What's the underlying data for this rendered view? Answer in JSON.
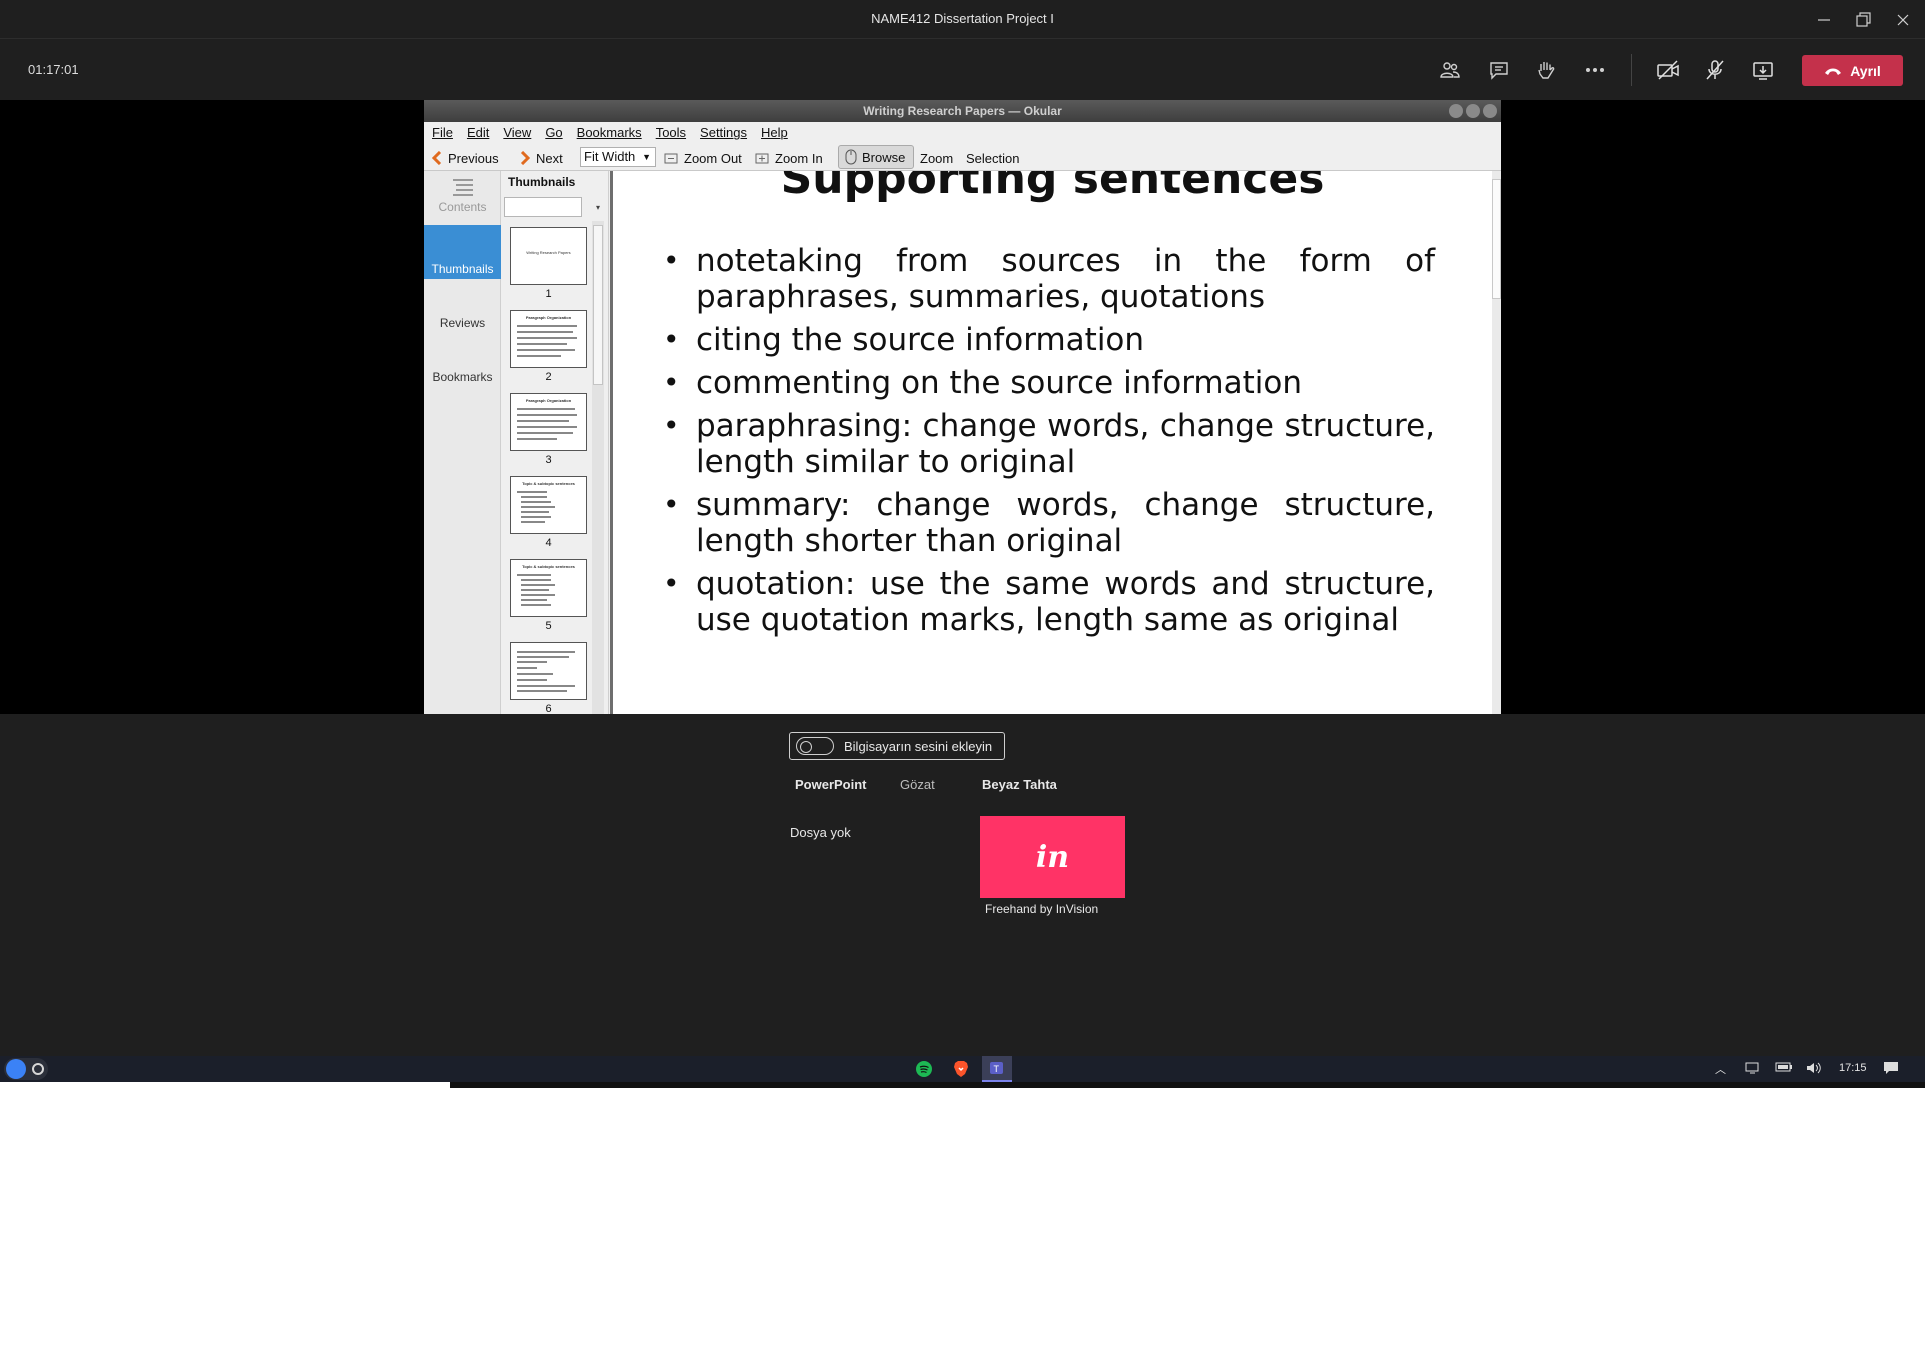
{
  "teams": {
    "window_title": "NAME412 Dissertation Project I",
    "timer": "01:17:01",
    "leave_label": "Ayrıl",
    "controls": [
      "people-icon",
      "chat-icon",
      "raise-hand-icon",
      "more-icon",
      "camera-off-icon",
      "mic-off-icon",
      "share-icon"
    ],
    "leave_color": "#c4314b"
  },
  "okular": {
    "title": "Writing Research Papers — Okular",
    "menu": [
      "File",
      "Edit",
      "View",
      "Go",
      "Bookmarks",
      "Tools",
      "Settings",
      "Help"
    ],
    "toolbar": {
      "previous": "Previous",
      "next": "Next",
      "fit_width": "Fit Width",
      "zoom_out": "Zoom Out",
      "zoom_in": "Zoom In",
      "browse": "Browse",
      "zoom": "Zoom",
      "selection": "Selection"
    },
    "side_tabs": [
      "Contents",
      "Thumbnails",
      "Reviews",
      "Bookmarks"
    ],
    "thumbnails_header": "Thumbnails",
    "thumbnails": [
      {
        "num": "1",
        "title": "Writing Research Papers"
      },
      {
        "num": "2",
        "title": "Paragraph Organization"
      },
      {
        "num": "3",
        "title": "Paragraph Organization"
      },
      {
        "num": "4",
        "title": "Topic & subtopic sentences"
      },
      {
        "num": "5",
        "title": "Topic & subtopic sentences"
      },
      {
        "num": "6",
        "title": ""
      }
    ],
    "slide": {
      "heading": "Supporting sentences",
      "bullets": [
        "notetaking from sources in the form of paraphrases, summaries, quotations",
        "citing the source information",
        "commenting on the source information",
        "paraphrasing: change words, change structure, length similar to original",
        "summary: change words, change structure, length shorter than original",
        "quotation: use the same words and structure, use quotation marks, length same as original"
      ]
    }
  },
  "tray": {
    "audio_toggle": "Bilgisayarın sesini ekleyin",
    "tabs": [
      "PowerPoint",
      "Gözat",
      "Beyaz Tahta"
    ],
    "no_file": "Dosya yok",
    "app_tile_logo": "in",
    "app_tile_label": "Freehand by InVision",
    "tile_color": "#ff3366"
  },
  "taskbar": {
    "clock": "17:15",
    "apps": [
      "spotify-icon",
      "brave-icon",
      "teams-icon"
    ]
  }
}
